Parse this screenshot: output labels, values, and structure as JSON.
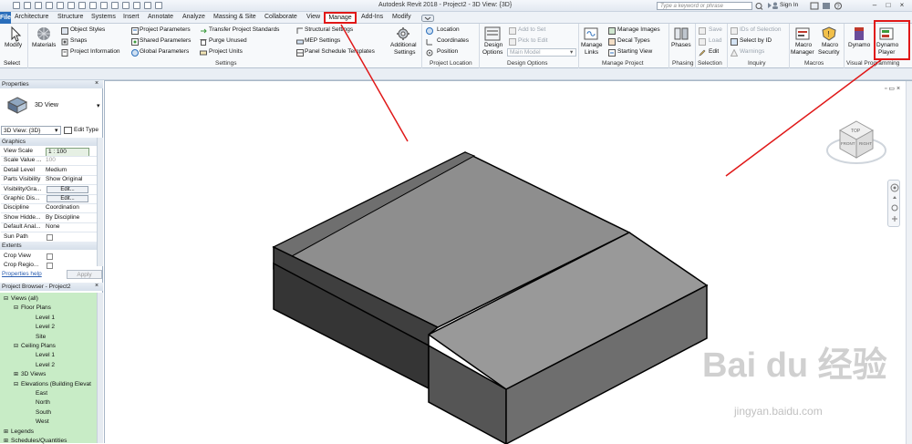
{
  "app_title": "Autodesk Revit 2018 -   Project2 - 3D View: {3D}",
  "search_placeholder": "Type a keyword or phrase",
  "signin": "Sign In",
  "tabs": [
    {
      "label": "File"
    },
    {
      "label": "Architecture"
    },
    {
      "label": "Structure"
    },
    {
      "label": "Systems"
    },
    {
      "label": "Insert"
    },
    {
      "label": "Annotate"
    },
    {
      "label": "Analyze"
    },
    {
      "label": "Massing & Site"
    },
    {
      "label": "Collaborate"
    },
    {
      "label": "View"
    },
    {
      "label": "Manage"
    },
    {
      "label": "Add-Ins"
    },
    {
      "label": "Modify"
    }
  ],
  "ribbon": {
    "select": {
      "modify": "Modify",
      "group": "Select"
    },
    "settings": {
      "materials": "Materials",
      "object_styles": "Object  Styles",
      "snaps": "Snaps",
      "project_info": "Project  Information",
      "project_params": "Project  Parameters",
      "shared_params": "Shared  Parameters",
      "global_params": "Global  Parameters",
      "transfer": "Transfer  Project Standards",
      "purge": "Purge  Unused",
      "units": "Project  Units",
      "structural": "Structural  Settings",
      "mep": "MEP  Settings",
      "panel": "Panel Schedule  Templates",
      "additional": "Additional",
      "additional2": "Settings",
      "group": "Settings"
    },
    "location": {
      "location": "Location",
      "coordinates": "Coordinates",
      "position": "Position",
      "group": "Project Location"
    },
    "design_options": {
      "btn": "Design",
      "btn2": "Options",
      "add": "Add to Set",
      "pick": "Pick to Edit",
      "main_model": "Main Model",
      "group": "Design Options"
    },
    "manage_project": {
      "links": "Manage",
      "links2": "Links",
      "images": "Manage  Images",
      "decal": "Decal  Types",
      "starting": "Starting  View",
      "group": "Manage Project"
    },
    "phasing": {
      "btn": "Phases",
      "group": "Phasing"
    },
    "selection": {
      "save": "Save",
      "load": "Load",
      "edit": "Edit",
      "group": "Selection"
    },
    "inquiry": {
      "ids": "IDs of Selection",
      "select_by_id": "Select  by ID",
      "warnings": "Warnings",
      "group": "Inquiry"
    },
    "macros": {
      "manager": "Macro",
      "manager2": "Manager",
      "security": "Macro",
      "security2": "Security",
      "group": "Macros"
    },
    "visual": {
      "dynamo": "Dynamo",
      "player": "Dynamo",
      "player2": "Player",
      "group": "Visual Programming"
    }
  },
  "properties": {
    "header": "Properties",
    "type_name": "3D View",
    "selector": "3D View: {3D}",
    "edit_type": "Edit Type",
    "section_graphics": "Graphics",
    "rows": [
      {
        "k": "View Scale",
        "v": "1 : 100"
      },
      {
        "k": "Scale Value ...",
        "v": "100"
      },
      {
        "k": "Detail Level",
        "v": "Medium"
      },
      {
        "k": "Parts Visibility",
        "v": "Show Original"
      },
      {
        "k": "Visibility/Gra...",
        "v": "Edit..."
      },
      {
        "k": "Graphic Dis...",
        "v": "Edit..."
      },
      {
        "k": "Discipline",
        "v": "Coordination"
      },
      {
        "k": "Show Hidde...",
        "v": "By Discipline"
      },
      {
        "k": "Default Anal...",
        "v": "None"
      },
      {
        "k": "Sun Path",
        "v": ""
      }
    ],
    "section_extents": "Extents",
    "ext_rows": [
      {
        "k": "Crop View"
      },
      {
        "k": "Crop Regio..."
      }
    ],
    "help": "Properties help",
    "apply": "Apply"
  },
  "browser": {
    "header": "Project Browser - Project2",
    "nodes": [
      {
        "label": "Views (all)",
        "indent": 0
      },
      {
        "label": "Floor Plans",
        "indent": 1
      },
      {
        "label": "Level 1",
        "indent": 2
      },
      {
        "label": "Level 2",
        "indent": 2
      },
      {
        "label": "Site",
        "indent": 2
      },
      {
        "label": "Ceiling Plans",
        "indent": 1
      },
      {
        "label": "Level 1",
        "indent": 2
      },
      {
        "label": "Level 2",
        "indent": 2
      },
      {
        "label": "3D Views",
        "indent": 1
      },
      {
        "label": "Elevations (Building Elevat",
        "indent": 1
      },
      {
        "label": "East",
        "indent": 2
      },
      {
        "label": "North",
        "indent": 2
      },
      {
        "label": "South",
        "indent": 2
      },
      {
        "label": "West",
        "indent": 2
      },
      {
        "label": "Legends",
        "indent": 0
      },
      {
        "label": "Schedules/Quantities",
        "indent": 0
      }
    ]
  },
  "viewcube": {
    "top_label": "TOP",
    "front_label": "FRONT",
    "right_label": "RIGHT"
  },
  "watermark": {
    "brand": "Bai du 经验",
    "url": "jingyan.baidu.com"
  },
  "colors": {
    "accent_blue": "#2a6ebb",
    "annotation_red": "#e01818",
    "browser_green": "#c8ecc6"
  }
}
